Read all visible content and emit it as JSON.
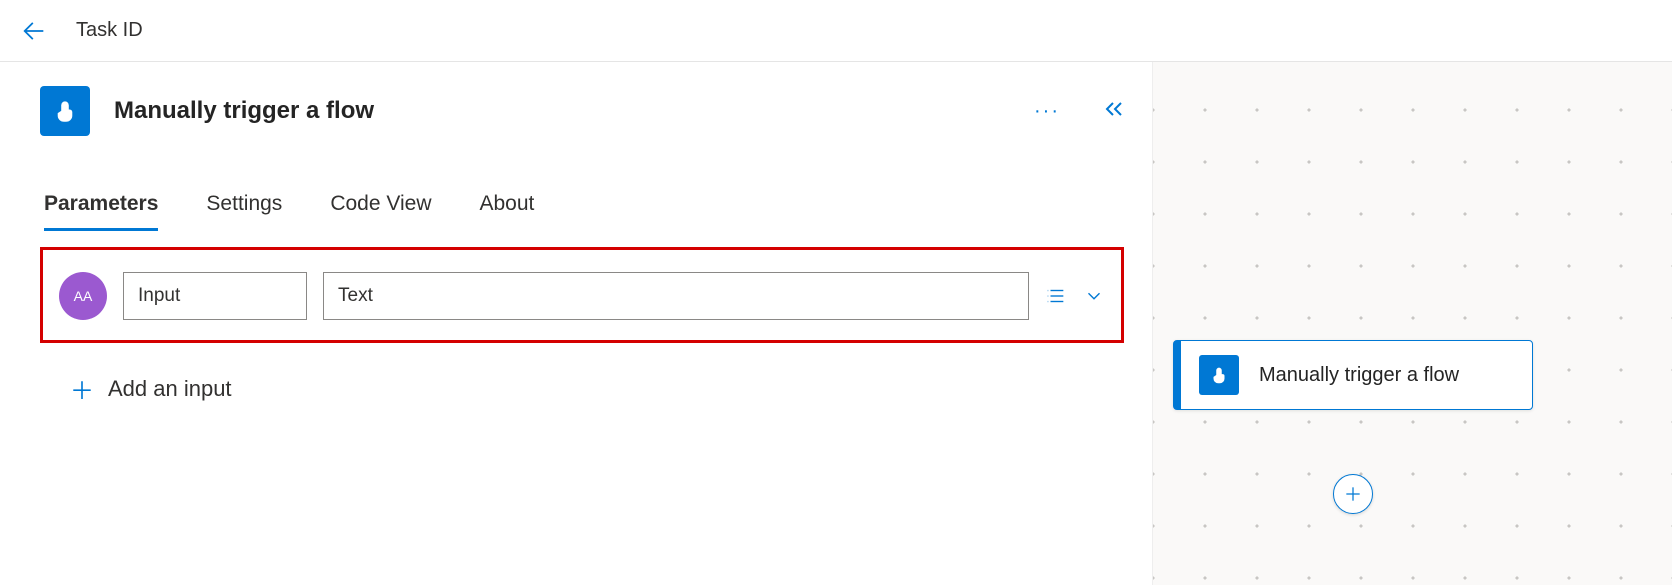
{
  "header": {
    "title": "Task ID"
  },
  "trigger": {
    "title": "Manually trigger a flow",
    "icon": "tap-icon"
  },
  "tabs": {
    "parameters": "Parameters",
    "settings": "Settings",
    "codeview": "Code View",
    "about": "About"
  },
  "inputRow": {
    "typeLabel": "AA",
    "name": "Input",
    "value": "Text"
  },
  "addInput": {
    "label": "Add an input"
  },
  "flowCard": {
    "label": "Manually trigger a flow"
  }
}
